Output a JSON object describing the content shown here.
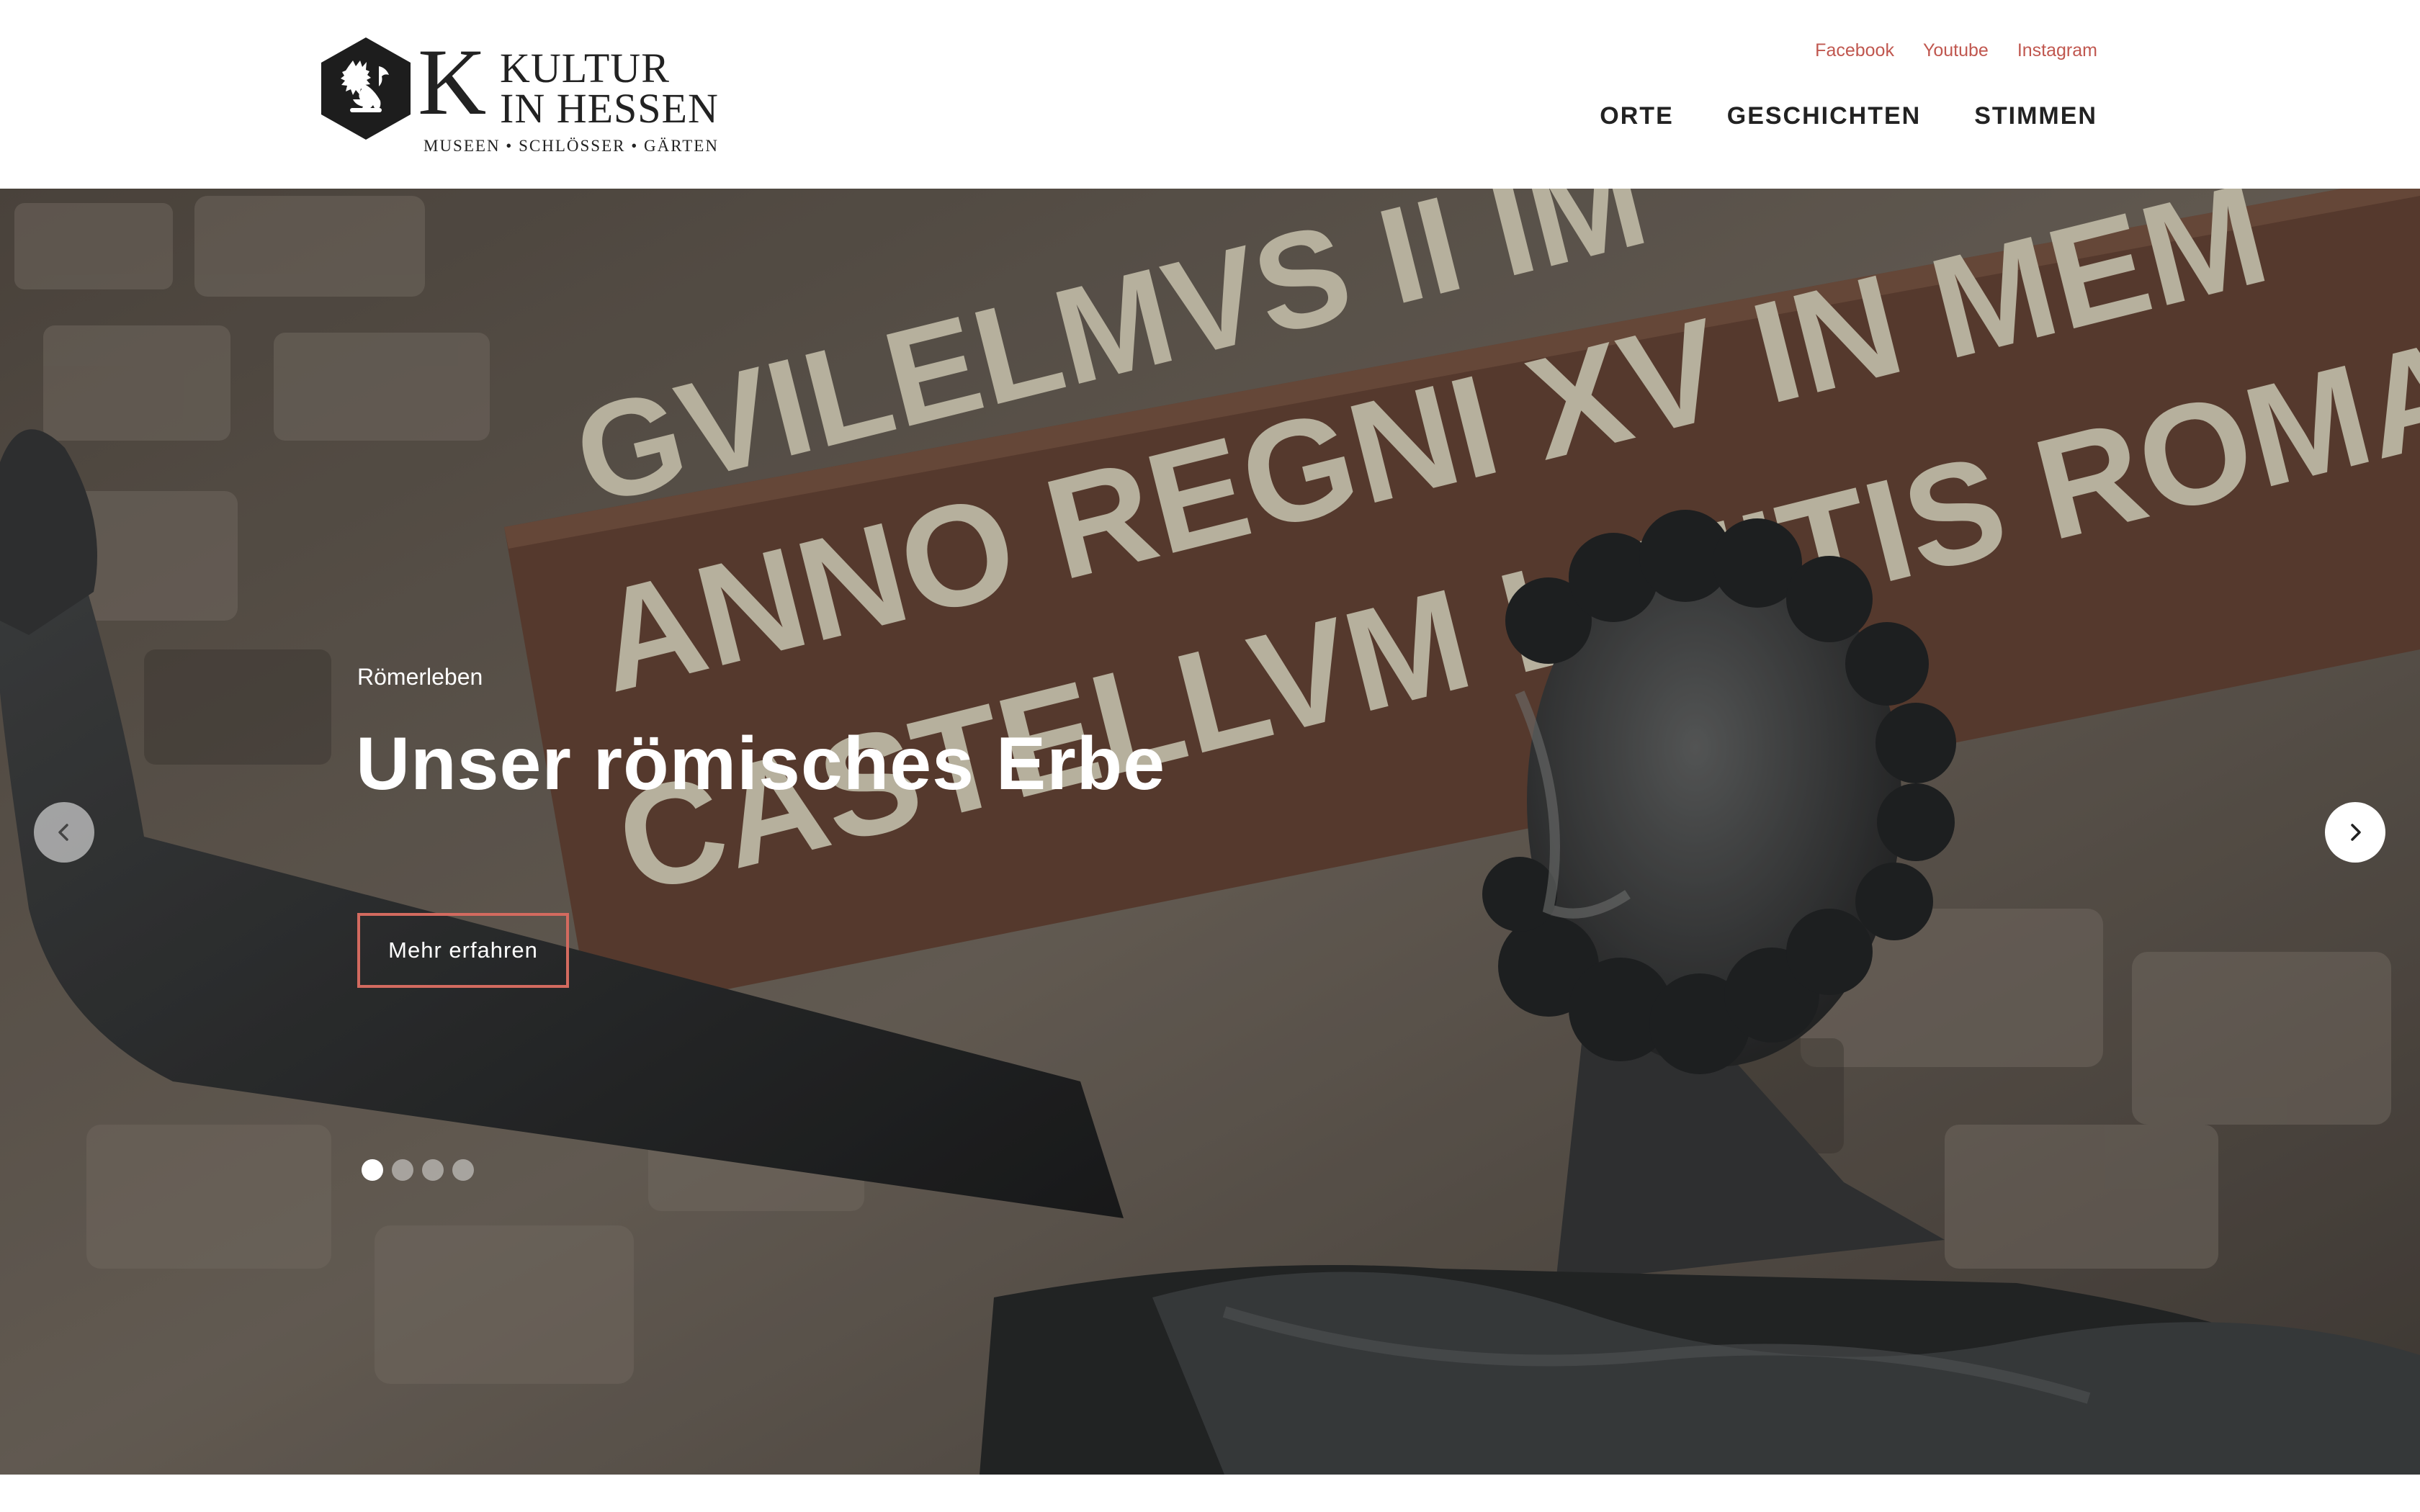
{
  "brand": {
    "logo_letter": "K",
    "logo_line1": "KULTUR",
    "logo_line2": "IN HESSEN",
    "logo_sub": "MUSEEN • SCHLÖSSER • GÄRTEN",
    "logo_icon": "lion-icon"
  },
  "social": [
    {
      "label": "Facebook"
    },
    {
      "label": "Youtube"
    },
    {
      "label": "Instagram"
    }
  ],
  "nav": [
    {
      "label": "ORTE"
    },
    {
      "label": "GESCHICHTEN"
    },
    {
      "label": "STIMMEN"
    }
  ],
  "hero": {
    "eyebrow": "Römerleben",
    "title": "Unser römisches Erbe",
    "cta_label": "Mehr erfahren",
    "inscription_line1": "GVILELMVS II IM",
    "inscription_line2": "ANNO REGNI XV IN MEM",
    "inscription_line3": "CASTELLVM LIMITIS ROMA",
    "slides_total": 4,
    "active_slide": 1
  },
  "colors": {
    "accent": "#c0574f",
    "cta_border": "#d36a5f",
    "text_dark": "#222222"
  }
}
